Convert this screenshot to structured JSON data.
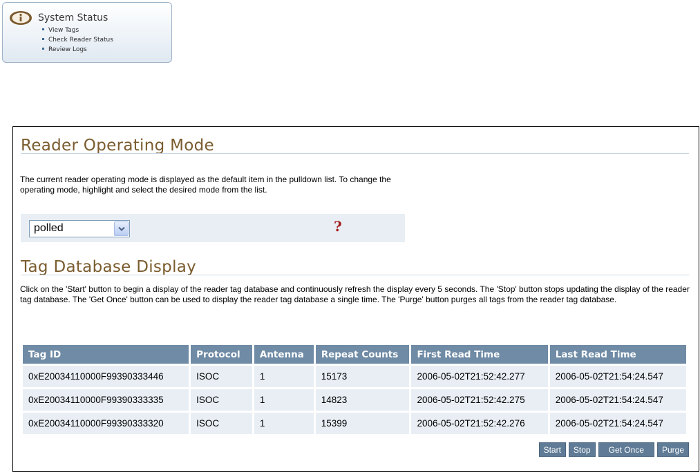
{
  "system_status": {
    "title": "System Status",
    "links": [
      "View Tags",
      "Check Reader Status",
      "Review Logs"
    ]
  },
  "reader_mode": {
    "heading": "Reader Operating Mode",
    "description": "The current reader operating mode is displayed as the default item in the pulldown list. To change the operating mode, highlight and select the desired mode from the list.",
    "selected_mode": "polled",
    "help_symbol": "?"
  },
  "tag_db": {
    "heading": "Tag Database Display",
    "description": "Click on the 'Start' button to begin a display of the reader tag database and continuously refresh the display every 5 seconds. The 'Stop' button stops updating the display of the reader tag database. The 'Get Once' button can be used to display the reader tag database a single time. The 'Purge' button purges all tags from the reader tag database.",
    "columns": [
      "Tag ID",
      "Protocol",
      "Antenna",
      "Repeat Counts",
      "First Read Time",
      "Last Read Time"
    ],
    "rows": [
      [
        "0xE20034110000F99390333446",
        "ISOC",
        "1",
        "15173",
        "2006-05-02T21:52:42.277",
        "2006-05-02T21:54:24.547"
      ],
      [
        "0xE20034110000F99390333335",
        "ISOC",
        "1",
        "14823",
        "2006-05-02T21:52:42.275",
        "2006-05-02T21:54:24.547"
      ],
      [
        "0xE20034110000F99390333320",
        "ISOC",
        "1",
        "15399",
        "2006-05-02T21:52:42.276",
        "2006-05-02T21:54:24.547"
      ]
    ],
    "buttons": {
      "start": "Start",
      "stop": "Stop",
      "get_once": "Get Once",
      "purge": "Purge"
    }
  },
  "colors": {
    "heading": "#7a5c2e",
    "table_header_bg": "#6f8ba5",
    "table_cell_bg": "#e8eef4",
    "button_bg": "#5f7b95",
    "help_mark": "#a31919"
  },
  "icons": {
    "status": "info-icon",
    "dropdown": "chevron-down-icon"
  }
}
